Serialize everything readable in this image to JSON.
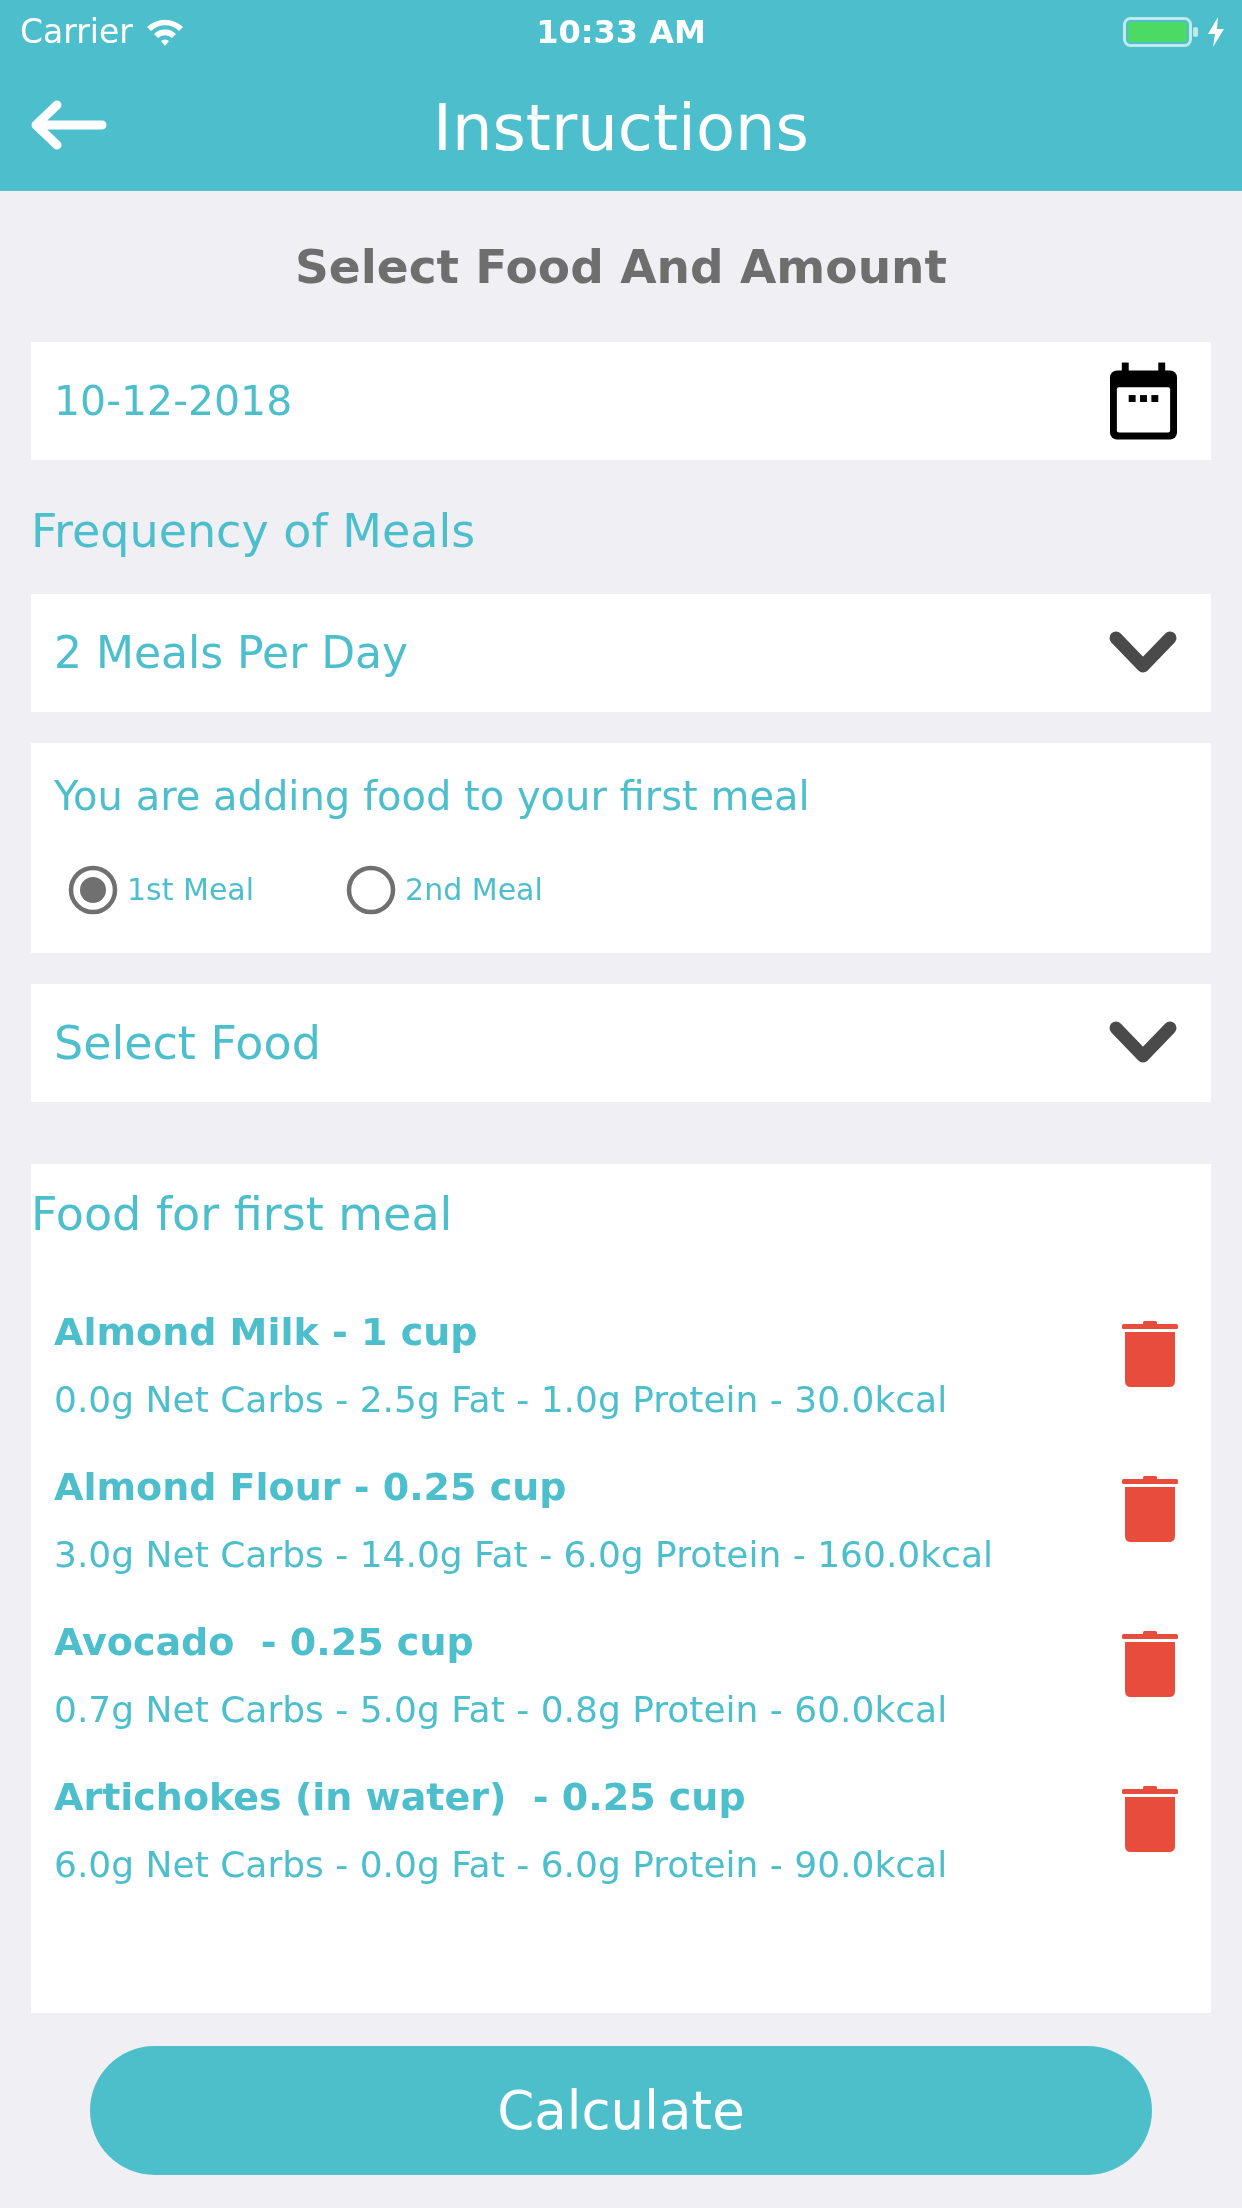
{
  "status_bar": {
    "carrier": "Carrier",
    "time": "10:33 AM"
  },
  "nav_bar": {
    "title": "Instructions"
  },
  "section_title": "Select Food And Amount",
  "date_field": {
    "value": "10-12-2018"
  },
  "frequency": {
    "label": "Frequency of Meals",
    "value": "2 Meals Per Day"
  },
  "meal_card": {
    "message": "You are adding food to your first meal",
    "options": [
      {
        "label": "1st Meal",
        "selected": true
      },
      {
        "label": "2nd Meal",
        "selected": false
      }
    ]
  },
  "food_dropdown": {
    "value": "Select Food"
  },
  "food_list": {
    "title": "Food for first meal",
    "items": [
      {
        "name": "Almond Milk - 1 cup",
        "nutrition": "0.0g Net Carbs - 2.5g Fat - 1.0g Protein - 30.0kcal"
      },
      {
        "name": "Almond Flour - 0.25 cup",
        "nutrition": "3.0g Net Carbs - 14.0g Fat - 6.0g Protein - 160.0kcal"
      },
      {
        "name": "Avocado  - 0.25 cup",
        "nutrition": "0.7g Net Carbs - 5.0g Fat - 0.8g Protein - 60.0kcal"
      },
      {
        "name": "Artichokes (in water)  - 0.25 cup",
        "nutrition": "6.0g Net Carbs - 0.0g Fat - 6.0g Protein - 90.0kcal"
      }
    ]
  },
  "calculate_button": {
    "label": "Calculate"
  }
}
